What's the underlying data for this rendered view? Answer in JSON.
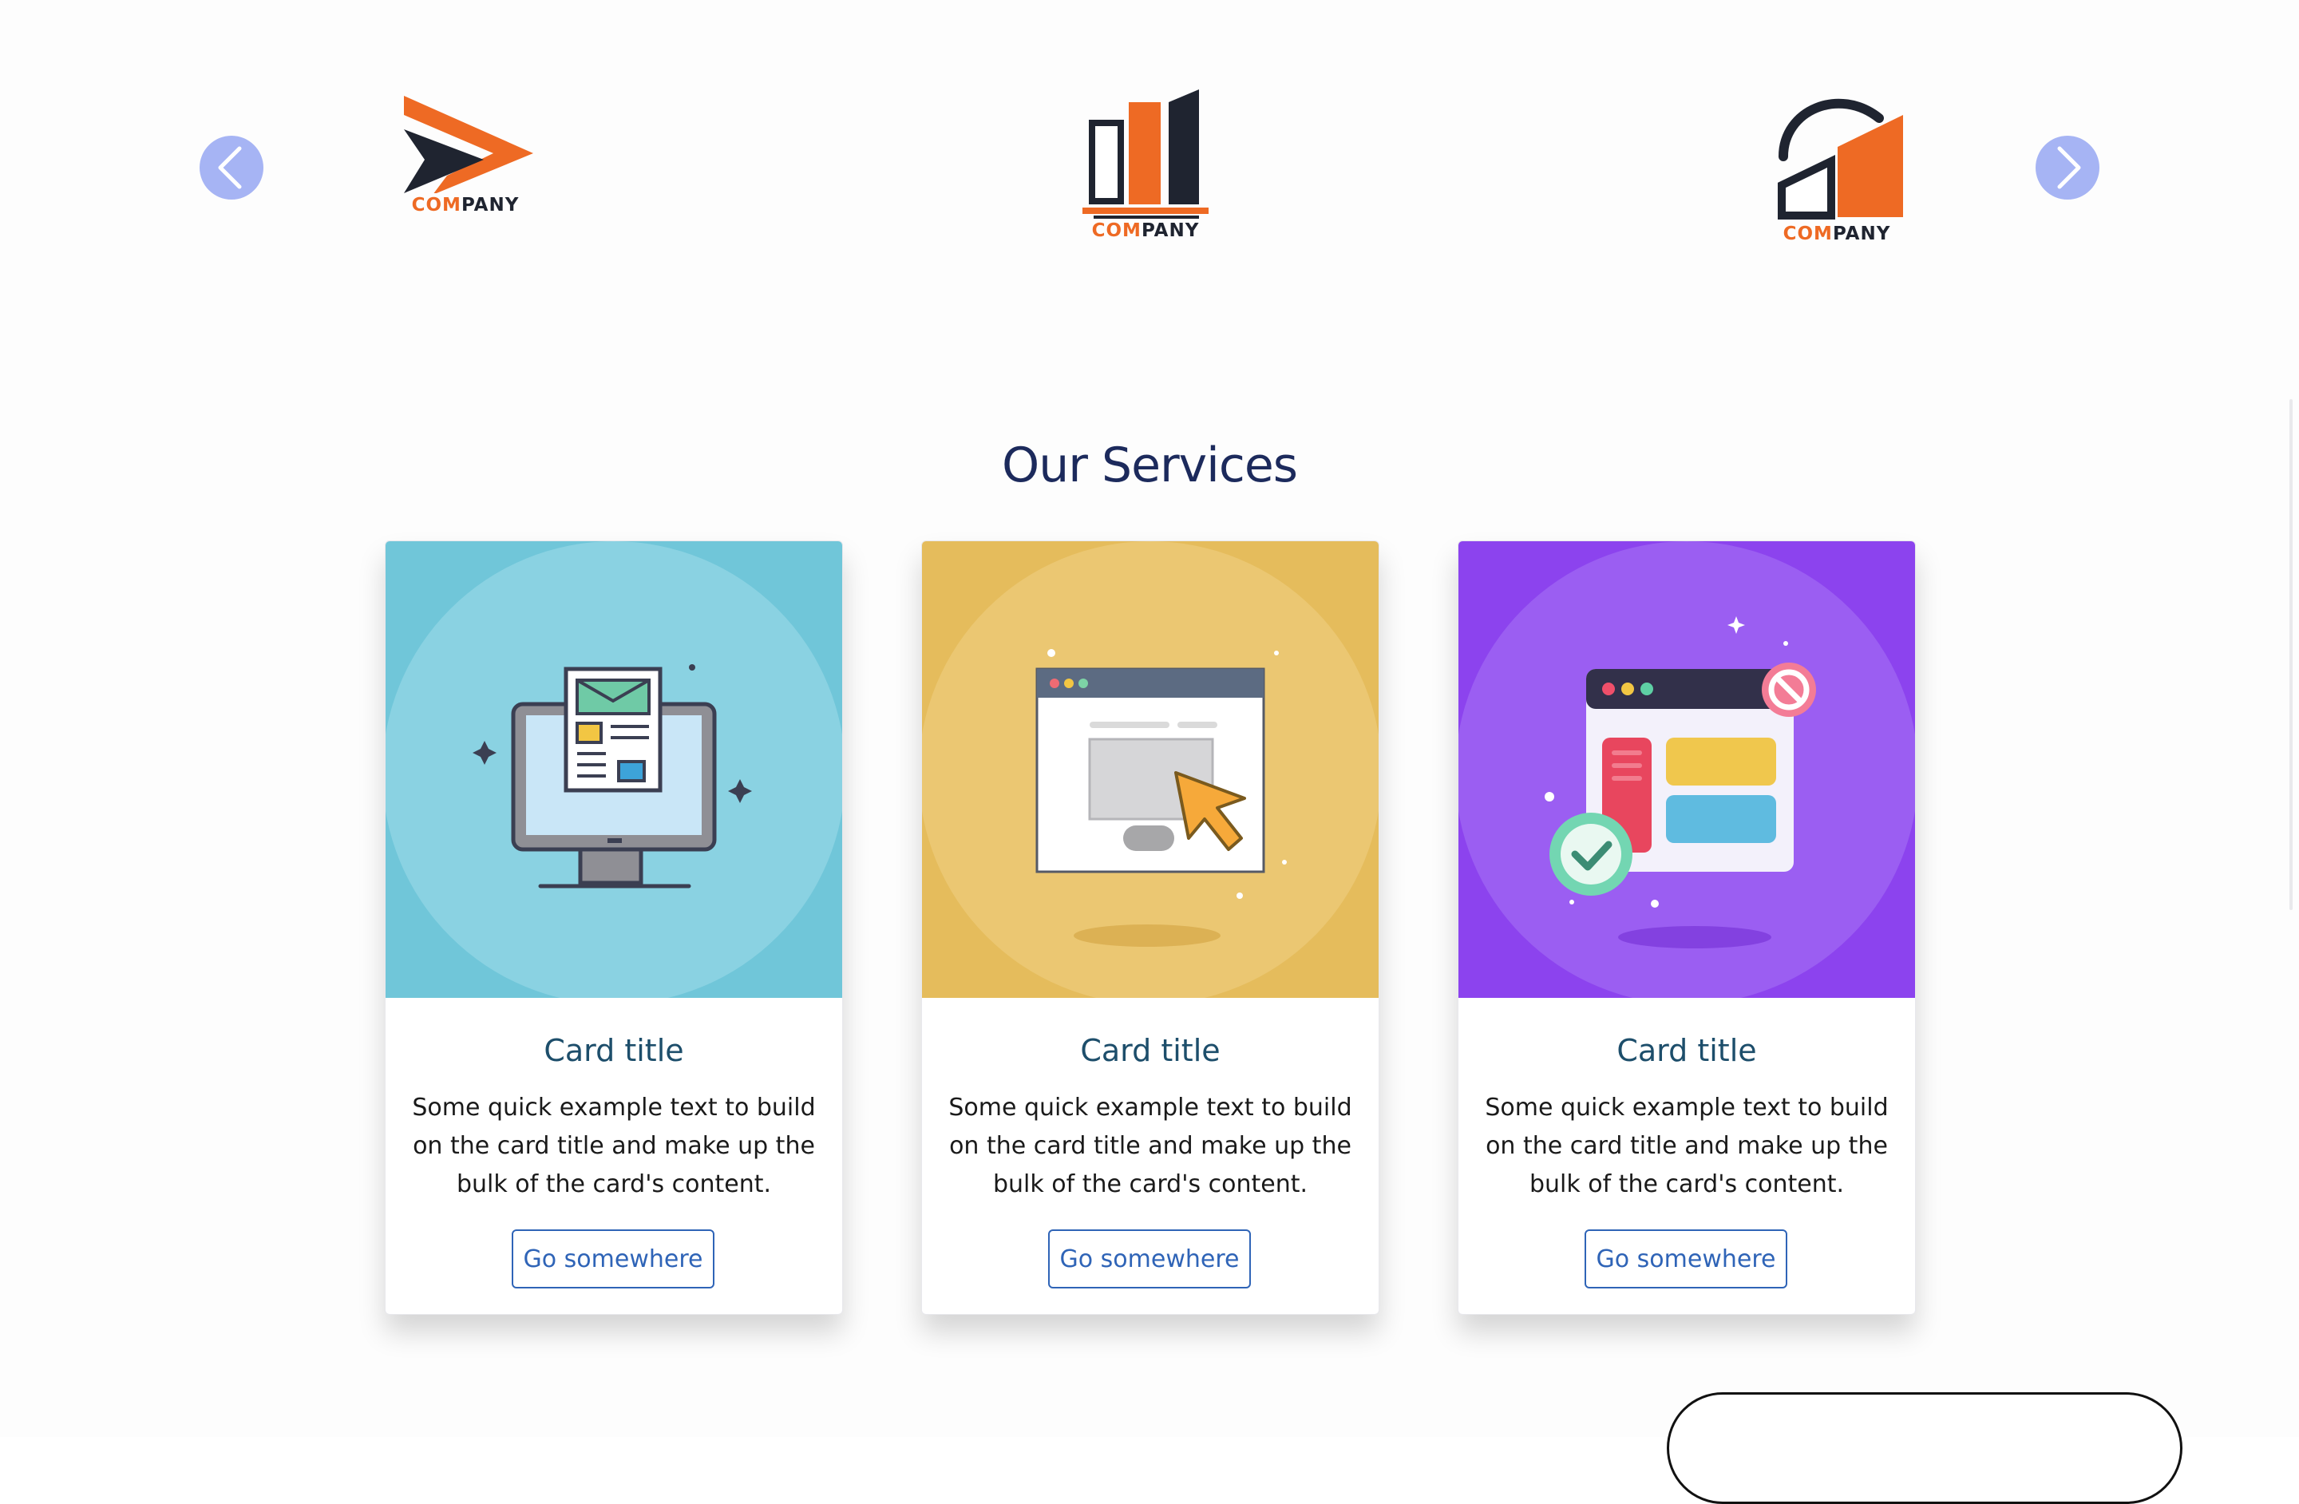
{
  "carousel": {
    "prev_icon": "chevron-left-icon",
    "next_icon": "chevron-right-icon",
    "logos": [
      {
        "name_prefix": "COM",
        "name_suffix": "PANY"
      },
      {
        "name_prefix": "COM",
        "name_suffix": "PANY"
      },
      {
        "name_prefix": "COM",
        "name_suffix": "PANY"
      }
    ]
  },
  "services": {
    "title": "Our Services",
    "cards": [
      {
        "title": "Card title",
        "text": "Some quick example text to build on the card title and make up the bulk of the card's content.",
        "button": "Go somewhere",
        "image_color": "#70c6d9",
        "icon": "monitor-newsletter-icon"
      },
      {
        "title": "Card title",
        "text": "Some quick example text to build on the card title and make up the bulk of the card's content.",
        "button": "Go somewhere",
        "image_color": "#e5bc5c",
        "icon": "browser-cursor-icon"
      },
      {
        "title": "Card title",
        "text": "Some quick example text to build on the card title and make up the bulk of the card's content.",
        "button": "Go somewhere",
        "image_color": "#8c43ee",
        "icon": "browser-check-block-icon"
      }
    ]
  },
  "colors": {
    "accent_orange": "#ee6a24",
    "logo_dark": "#1f2430",
    "arrow_bg": "#a6b4f4",
    "title_navy": "#1c2a5c",
    "card_title": "#1d4e6b",
    "button_blue": "#2f64b7"
  }
}
